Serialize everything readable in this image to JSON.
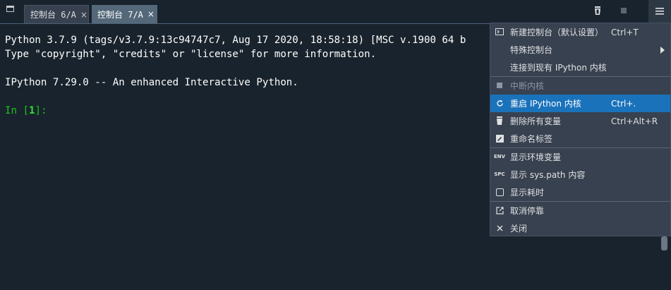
{
  "tabs": [
    {
      "label": "控制台 6/A",
      "close": "×"
    },
    {
      "label": "控制台 7/A",
      "close": "×"
    }
  ],
  "toolbar": {
    "remove_vars_icon": "trash-icon",
    "interrupt_icon": "stop-icon",
    "options_icon": "hamburger-menu-icon"
  },
  "console": {
    "line1": "Python 3.7.9 (tags/v3.7.9:13c94747c7, Aug 17 2020, 18:58:18) [MSC v.1900 64 b",
    "line2": "Type \"copyright\", \"credits\" or \"license\" for more information.",
    "line3": "IPython 7.29.0 -- An enhanced Interactive Python.",
    "prompt_prefix": "In [",
    "prompt_number": "1",
    "prompt_suffix": "]:"
  },
  "menu": {
    "new_console": {
      "label": "新建控制台（默认设置）",
      "shortcut": "Ctrl+T"
    },
    "special_console": {
      "label": "特殊控制台"
    },
    "connect_kernel": {
      "label": "连接到现有 IPython 内核"
    },
    "interrupt_kernel": {
      "label": "中断内核"
    },
    "restart_kernel": {
      "label": "重启 IPython 内核",
      "shortcut": "Ctrl+."
    },
    "remove_vars": {
      "label": "删除所有变量",
      "shortcut": "Ctrl+Alt+R"
    },
    "rename_tab": {
      "label": "重命名标签"
    },
    "show_env": {
      "label": "显示环境变量",
      "icon_text": "ENV"
    },
    "show_syspath": {
      "label": "显示 sys.path 内容",
      "icon_text": "SPC"
    },
    "show_time": {
      "label": "显示耗时"
    },
    "undock": {
      "label": "取消停靠"
    },
    "close": {
      "label": "关闭"
    }
  },
  "colors": {
    "background": "#19232d",
    "menu_bg": "#37414f",
    "selection": "#1a72bb",
    "prompt": "#20c020"
  }
}
